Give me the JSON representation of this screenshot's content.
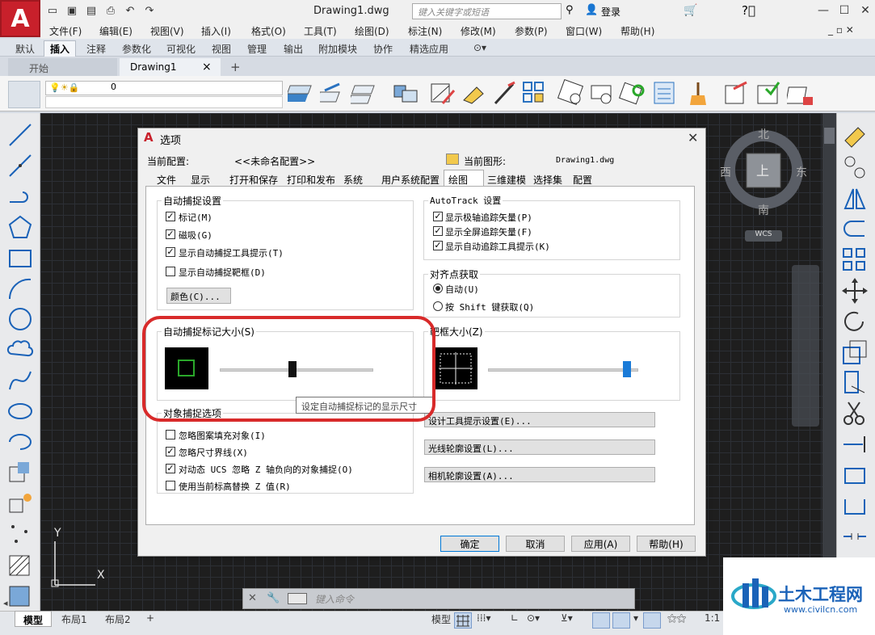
{
  "app": {
    "title": "Drawing1.dwg",
    "logo_letter": "A",
    "search_placeholder": "键入关键字或短语",
    "login_label": "登录"
  },
  "menu": [
    "文件(F)",
    "编辑(E)",
    "视图(V)",
    "插入(I)",
    "格式(O)",
    "工具(T)",
    "绘图(D)",
    "标注(N)",
    "修改(M)",
    "参数(P)",
    "窗口(W)",
    "帮助(H)"
  ],
  "ribbon_tabs": [
    "默认",
    "插入",
    "注释",
    "参数化",
    "可视化",
    "视图",
    "管理",
    "输出",
    "附加模块",
    "协作",
    "精选应用"
  ],
  "ribbon_active": "插入",
  "doc_tabs": {
    "start": "开始",
    "drawing": "Drawing1",
    "close": "×",
    "add": "+"
  },
  "layer": {
    "value": "0"
  },
  "viewcube": {
    "north": "北",
    "south": "南",
    "west": "西",
    "east": "东",
    "top": "上",
    "wcs": "WCS"
  },
  "ucs": {
    "x": "X",
    "y": "Y"
  },
  "command": {
    "placeholder": "键入命令"
  },
  "layout_tabs": [
    "模型",
    "布局1",
    "布局2"
  ],
  "status": {
    "model": "模型",
    "scale": "1:1"
  },
  "dialog": {
    "title": "选项",
    "current_profile_label": "当前配置:",
    "current_profile_value": "<<未命名配置>>",
    "current_drawing_label": "当前图形:",
    "current_drawing_value": "Drawing1.dwg",
    "tabs": [
      "文件",
      "显示",
      "打开和保存",
      "打印和发布",
      "系统",
      "用户系统配置",
      "绘图",
      "三维建模",
      "选择集",
      "配置"
    ],
    "active_tab": "绘图",
    "autosnap": {
      "title": "自动捕捉设置",
      "items": [
        {
          "label": "标记(M)",
          "checked": true
        },
        {
          "label": "磁吸(G)",
          "checked": true
        },
        {
          "label": "显示自动捕捉工具提示(T)",
          "checked": true
        },
        {
          "label": "显示自动捕捉靶框(D)",
          "checked": false
        }
      ],
      "color_button": "颜色(C)..."
    },
    "autotrack": {
      "title": "AutoTrack 设置",
      "items": [
        {
          "label": "显示极轴追踪矢量(P)",
          "checked": true
        },
        {
          "label": "显示全屏追踪矢量(F)",
          "checked": true
        },
        {
          "label": "显示自动追踪工具提示(K)",
          "checked": true
        }
      ]
    },
    "alignment": {
      "title": "对齐点获取",
      "options": [
        {
          "label": "自动(U)",
          "selected": true
        },
        {
          "label": "按 Shift 键获取(Q)",
          "selected": false
        }
      ]
    },
    "marker_size": {
      "title": "自动捕捉标记大小(S)",
      "level": 0.47
    },
    "aperture_size": {
      "title": "靶框大小(Z)",
      "level": 0.95
    },
    "tooltip": "设定自动捕捉标记的显示尺寸",
    "osnap": {
      "title": "对象捕捉选项",
      "items": [
        {
          "label": "忽略图案填充对象(I)",
          "checked": false
        },
        {
          "label": "忽略尺寸界线(X)",
          "checked": true
        },
        {
          "label": "对动态 UCS 忽略 Z 轴负向的对象捕捉(O)",
          "checked": true
        },
        {
          "label": "使用当前标高替换 Z 值(R)",
          "checked": false
        }
      ]
    },
    "buttons_right": [
      "设计工具提示设置(E)...",
      "光线轮廓设置(L)...",
      "相机轮廓设置(A)..."
    ],
    "footer": {
      "ok": "确定",
      "cancel": "取消",
      "apply": "应用(A)",
      "help": "帮助(H)"
    },
    "check_mark": "✓",
    "close": "✕"
  },
  "watermark": {
    "title": "土木工程网",
    "url": "www.civilcn.com"
  },
  "colors": {
    "highlight": "#d82a2a",
    "accent": "#1a7bd8",
    "snap_green": "#2aa82a",
    "brand": "#c8202b"
  }
}
